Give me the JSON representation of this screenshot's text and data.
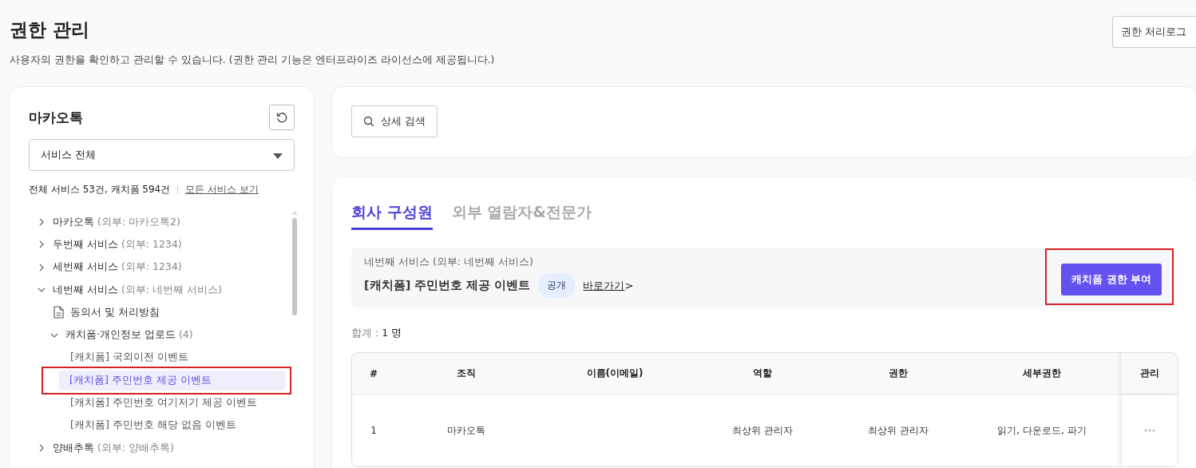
{
  "page": {
    "title": "권한 관리",
    "description": "사용자의 권한을 확인하고 관리할 수 있습니다. (권한 관리 기능은 엔터프라이즈 라이선스에 제공됩니다.)",
    "log_button": "권한 처리로그"
  },
  "sidebar": {
    "title": "마카오톡",
    "service_select": {
      "value": "서비스 전체"
    },
    "summary": "전체 서비스 53건, 캐치폼 594건",
    "all_services_link": "모든 서비스 보기",
    "tree": [
      {
        "kind": "folder",
        "name": "마카오톡",
        "external": "(외부: 마카오톡2)",
        "expanded": false,
        "selected": false
      },
      {
        "kind": "folder",
        "name": "두번째 서비스",
        "external": "(외부: 1234)",
        "expanded": false,
        "selected": false
      },
      {
        "kind": "folder",
        "name": "세번째 서비스",
        "external": "(외부: 1234)",
        "expanded": false,
        "selected": false
      },
      {
        "kind": "folder",
        "name": "네번째 서비스",
        "external": "(외부: 네번째 서비스)",
        "expanded": true,
        "selected": false,
        "children": [
          {
            "kind": "document",
            "name": "동의서 및 처리방침",
            "selected": false
          },
          {
            "kind": "folder",
            "name": "캐치폼·개인정보 업로드",
            "external": "(4)",
            "expanded": true,
            "selected": false,
            "children": [
              {
                "kind": "leaf",
                "name": "[캐치폼] 국외이전 이벤트",
                "selected": false
              },
              {
                "kind": "leaf",
                "name": "[캐치폼] 주민번호 제공 이벤트",
                "selected": true,
                "annotated": true
              },
              {
                "kind": "leaf",
                "name": "[캐치폼] 주민번호 여기저기 제공 이벤트",
                "selected": false
              },
              {
                "kind": "leaf",
                "name": "[캐치폼] 주민번호 해당 없음 이벤트",
                "selected": false
              }
            ]
          }
        ]
      },
      {
        "kind": "folder",
        "name": "양배추톡",
        "external": "(외부: 양배추톡)",
        "expanded": false,
        "selected": false
      }
    ]
  },
  "search": {
    "button": "상세 검색"
  },
  "tabs": [
    {
      "label": "회사 구성원",
      "selected": true
    },
    {
      "label": "외부 열람자&전문가",
      "selected": false
    }
  ],
  "form_info": {
    "service": "네번째 서비스 (외부: 네번째 서비스)",
    "form_name": "[캐치폼] 주민번호 제공 이벤트",
    "badge": "공개",
    "link": "바로가기",
    "link_suffix": ">",
    "grant_button": {
      "label": "캐치폼 권한 부여",
      "annotated": true
    }
  },
  "total": {
    "label": "합계 :",
    "value": "1 명"
  },
  "table": {
    "columns": [
      "#",
      "조직",
      "이름(이메일)",
      "역할",
      "권한",
      "세부권한",
      "관리"
    ],
    "rows": [
      {
        "cells": [
          "1",
          "마카오톡",
          "",
          "최상위 관리자",
          "최상위 관리자",
          "읽기, 다운로드, 파기"
        ]
      }
    ]
  }
}
